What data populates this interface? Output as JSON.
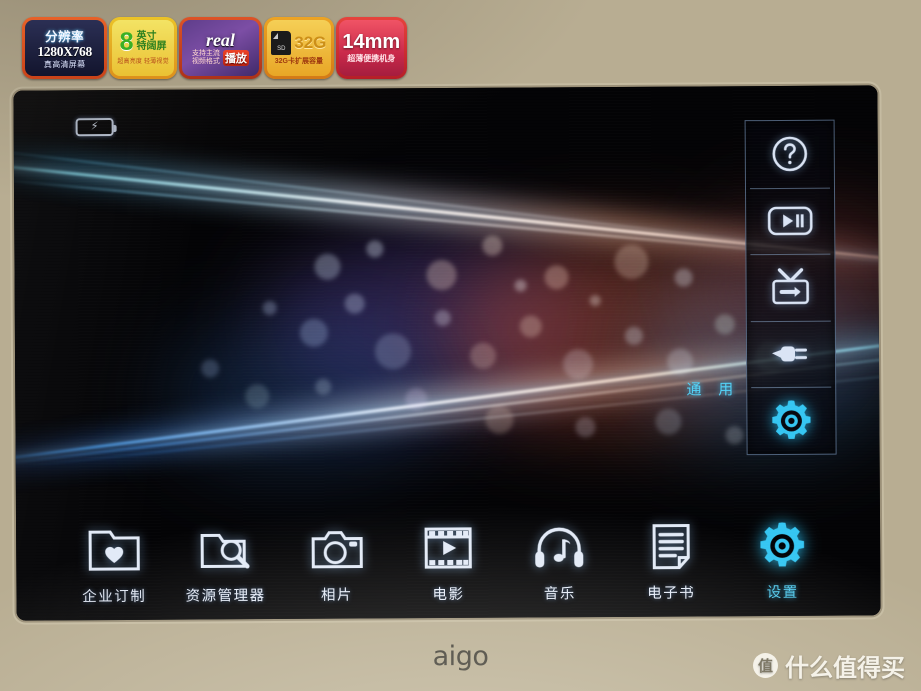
{
  "device": {
    "brand": "aigo",
    "bezel_color": "#cbc0a2"
  },
  "stickers": [
    {
      "name": "resolution",
      "line1": "分辨率",
      "line2": "1280X768",
      "line3": "真高清屏幕",
      "color": "#2b2f52"
    },
    {
      "name": "screen-size",
      "big": "8",
      "line1": "英寸",
      "line2": "特阔屏",
      "line3": "超高亮度 轻薄视觉",
      "color": "#e8c13a"
    },
    {
      "name": "real-format",
      "logo": "real",
      "line1": "支持主流",
      "line2": "视频格式",
      "badge": "播放",
      "color": "#7b4fa2"
    },
    {
      "name": "sd-card",
      "card_label": "SD",
      "big": "32G",
      "line3": "32G卡扩展容量",
      "color": "#e5a62c"
    },
    {
      "name": "thickness",
      "big": "14mm",
      "line3": "超薄便携机身",
      "color": "#c32b4a"
    }
  ],
  "screen": {
    "status": {
      "battery_icon": "battery-charging-icon",
      "battery_glyph": "⚡"
    },
    "side_panel": {
      "items": [
        {
          "icon": "help-question-icon",
          "label": "帮助"
        },
        {
          "icon": "play-pause-icon",
          "label": "播放/暂停"
        },
        {
          "icon": "tv-output-icon",
          "label": "电视输出"
        },
        {
          "icon": "power-plug-icon",
          "label": "电源"
        },
        {
          "icon": "gear-settings-icon",
          "label": "通用",
          "selected": true
        }
      ]
    },
    "general_label": "通 用",
    "accent_color": "#35c6f2",
    "dock": [
      {
        "icon": "folder-heart-icon",
        "label": "企业订制",
        "selected": false
      },
      {
        "icon": "folder-search-icon",
        "label": "资源管理器",
        "selected": false
      },
      {
        "icon": "camera-icon",
        "label": "相片",
        "selected": false
      },
      {
        "icon": "film-play-icon",
        "label": "电影",
        "selected": false
      },
      {
        "icon": "headphones-music-icon",
        "label": "音乐",
        "selected": false
      },
      {
        "icon": "document-lines-icon",
        "label": "电子书",
        "selected": false
      },
      {
        "icon": "gear-settings-icon",
        "label": "设置",
        "selected": true
      }
    ]
  },
  "watermark": {
    "logo_char": "值",
    "text": "什么值得买"
  }
}
